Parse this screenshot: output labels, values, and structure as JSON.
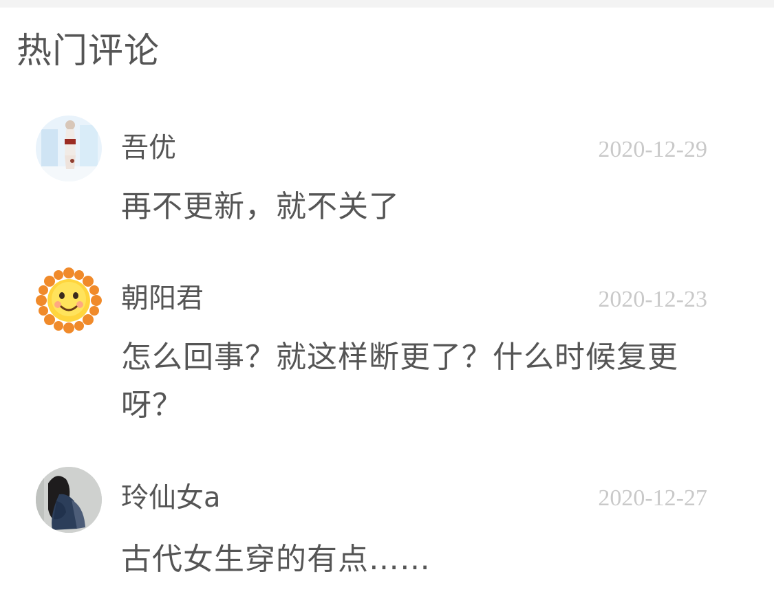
{
  "section": {
    "title": "热门评论"
  },
  "comments": [
    {
      "avatar_icon": "user-avatar-photo-icon",
      "username": "吾优",
      "date": "2020-12-29",
      "text": "再不更新，就不关了"
    },
    {
      "avatar_icon": "sun-flower-avatar-icon",
      "username": "朝阳君",
      "date": "2020-12-23",
      "text": "怎么回事？就这样断更了？什么时候复更呀？"
    },
    {
      "avatar_icon": "user-avatar-photo-icon",
      "username": "玲仙女a",
      "date": "2020-12-27",
      "text": "古代女生穿的有点……"
    }
  ],
  "colors": {
    "text": "#555555",
    "date": "#c9c9c9",
    "top_strip": "#f3f3f3"
  }
}
